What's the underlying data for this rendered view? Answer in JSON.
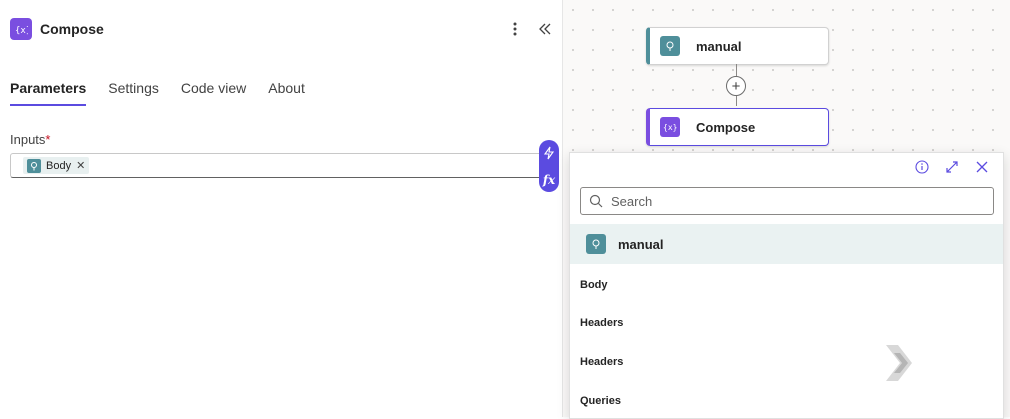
{
  "panel": {
    "title": "Compose",
    "icon": "expression-icon",
    "tabs": [
      {
        "label": "Parameters",
        "active": true
      },
      {
        "label": "Settings",
        "active": false
      },
      {
        "label": "Code view",
        "active": false
      },
      {
        "label": "About",
        "active": false
      }
    ],
    "inputs": {
      "label": "Inputs",
      "required_mark": "*",
      "token": {
        "label": "Body",
        "icon": "trigger-icon"
      }
    },
    "insert_buttons": [
      "lightning-icon",
      "fx-icon"
    ]
  },
  "canvas": {
    "nodes": [
      {
        "label": "manual",
        "icon": "trigger-icon",
        "accent": "#4f8f9a"
      },
      {
        "label": "Compose",
        "icon": "expression-icon",
        "accent": "#7a4ee0"
      }
    ]
  },
  "popup": {
    "search_placeholder": "Search",
    "group": {
      "label": "manual",
      "icon": "trigger-icon"
    },
    "items": [
      "Body",
      "Headers",
      "Headers",
      "Queries"
    ]
  },
  "colors": {
    "accent": "#5b4be0",
    "trigger": "#4f8f9a",
    "expression": "#7a4ee0"
  }
}
